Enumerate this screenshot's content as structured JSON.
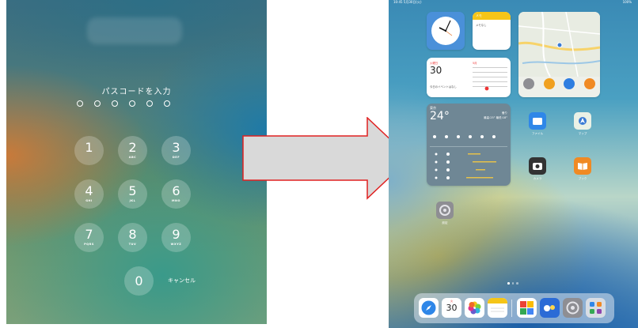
{
  "lock_screen": {
    "prompt": "パスコードを入力",
    "keys": [
      {
        "num": "1",
        "letters": ""
      },
      {
        "num": "2",
        "letters": "ABC"
      },
      {
        "num": "3",
        "letters": "DEF"
      },
      {
        "num": "4",
        "letters": "GHI"
      },
      {
        "num": "5",
        "letters": "JKL"
      },
      {
        "num": "6",
        "letters": "MNO"
      },
      {
        "num": "7",
        "letters": "PQRS"
      },
      {
        "num": "8",
        "letters": "TUV"
      },
      {
        "num": "9",
        "letters": "WXYZ"
      },
      {
        "num": "0",
        "letters": ""
      }
    ],
    "cancel_label": "キャンセル"
  },
  "home_screen": {
    "status": {
      "time": "10:45  5月30日(火)",
      "battery": "100%"
    },
    "calendar_widget": {
      "weekday": "火曜日",
      "day": "30",
      "month": "5月",
      "event": "今日のイベントはなし"
    },
    "notes_widget": {
      "title": "メモ",
      "body": "メモなし"
    },
    "weather_widget": {
      "city": "東京",
      "temp": "24°",
      "condition": "曇り",
      "range": "最高:25° 最低:18°"
    },
    "apps": {
      "files": "ファイル",
      "maps": "マップ",
      "camera": "カメラ",
      "books": "ブック",
      "settings": "設定"
    },
    "dock_calendar_day": "30",
    "dock_calendar_weekday": "火"
  },
  "colors": {
    "arrow_fill": "#d9d9d9",
    "arrow_stroke": "#e02020"
  }
}
